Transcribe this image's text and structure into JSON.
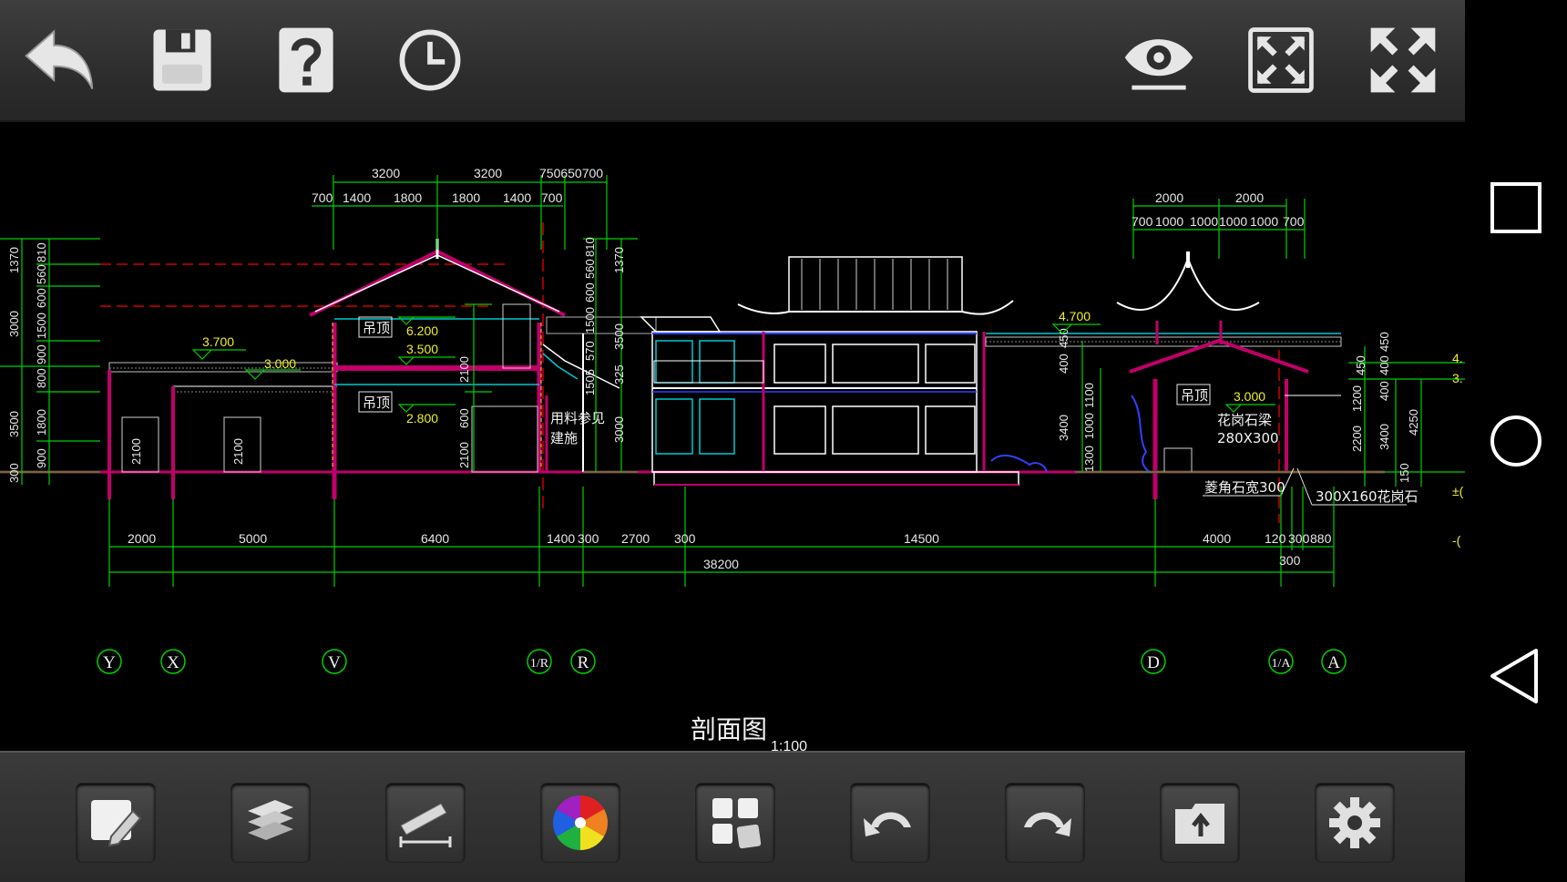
{
  "app": {
    "toolbar_top": {
      "left": [
        {
          "name": "back-button",
          "icon": "back-arrow-icon"
        },
        {
          "name": "save-button",
          "icon": "floppy-disk-icon"
        },
        {
          "name": "help-button",
          "icon": "question-mark-icon"
        },
        {
          "name": "history-button",
          "icon": "clock-icon"
        }
      ],
      "right": [
        {
          "name": "view-button",
          "icon": "eye-icon"
        },
        {
          "name": "zoom-extents-button",
          "icon": "zoom-extents-icon"
        },
        {
          "name": "fullscreen-button",
          "icon": "fullscreen-arrows-icon"
        }
      ]
    },
    "toolbar_bottom": [
      {
        "name": "edit-button",
        "icon": "pencil-note-icon"
      },
      {
        "name": "layers-button",
        "icon": "layers-icon"
      },
      {
        "name": "measure-button",
        "icon": "ruler-icon"
      },
      {
        "name": "color-button",
        "icon": "color-wheel-icon"
      },
      {
        "name": "blocks-button",
        "icon": "blocks-icon"
      },
      {
        "name": "undo-button",
        "icon": "undo-icon"
      },
      {
        "name": "redo-button",
        "icon": "redo-icon"
      },
      {
        "name": "export-button",
        "icon": "folder-export-icon"
      },
      {
        "name": "settings-button",
        "icon": "gear-icon"
      }
    ],
    "android_nav": [
      {
        "name": "recent-apps-button",
        "icon": "square-icon"
      },
      {
        "name": "home-button",
        "icon": "circle-icon"
      },
      {
        "name": "back-nav-button",
        "icon": "triangle-back-icon"
      }
    ]
  },
  "drawing": {
    "title": "剖面图",
    "scale": "1:100",
    "colors": {
      "dim": "#00d000",
      "wall": "#c0006a",
      "outline": "#ffffff",
      "blue": "#3040ff",
      "cyan": "#00c8d0",
      "red": "#d00000",
      "yellow": "#e8e820"
    },
    "dims_top_left_row1": [
      "3200",
      "3200",
      "750650700"
    ],
    "dims_top_left_row2": [
      "700",
      "1400",
      "1800",
      "1800",
      "1400",
      "700"
    ],
    "dims_top_right_row1": [
      "2000",
      "2000"
    ],
    "dims_top_right_row2": [
      "700",
      "1000",
      "1000",
      "1000",
      "1000",
      "700"
    ],
    "dims_left_col1": [
      "1370",
      "3000",
      "3500",
      "300"
    ],
    "dims_left_col2": [
      "560",
      "810",
      "1500",
      "600",
      "900",
      "800",
      "1800",
      "900"
    ],
    "dims_mid_col": [
      "560",
      "810",
      "1500",
      "600",
      "1370",
      "570",
      "1505",
      "3500",
      "325",
      "3000"
    ],
    "dims_right_col1": [
      "400",
      "450",
      "1200",
      "2200",
      "150"
    ],
    "dims_right_col2": [
      "400",
      "450",
      "3400",
      "4250"
    ],
    "dims_right_inner": [
      "400",
      "450",
      "1100",
      "1000",
      "1300",
      "3400"
    ],
    "dims_heights": [
      "2100",
      "2100",
      "2100",
      "600",
      "2100"
    ],
    "levels": [
      "3.700",
      "3.000",
      "6.200",
      "3.500",
      "2.800",
      "4.700",
      "3.000"
    ],
    "notes": [
      "吊顶",
      "吊顶",
      "用料参见",
      "建施",
      "吊顶",
      "花岗石梁",
      "280X300",
      "菱角石宽300",
      "300X160花岗石"
    ],
    "dims_bottom_row1": [
      "2000",
      "5000",
      "6400",
      "1400",
      "300",
      "2700",
      "300",
      "14500",
      "4000",
      "120",
      "300",
      "880"
    ],
    "dims_bottom_total": "38200",
    "dims_bottom_sub": "300",
    "axes": [
      "Y",
      "X",
      "V",
      "1/R",
      "R",
      "D",
      "1/A",
      "A"
    ],
    "partial_right": [
      "4.",
      "3.",
      "±(",
      "-("
    ]
  }
}
